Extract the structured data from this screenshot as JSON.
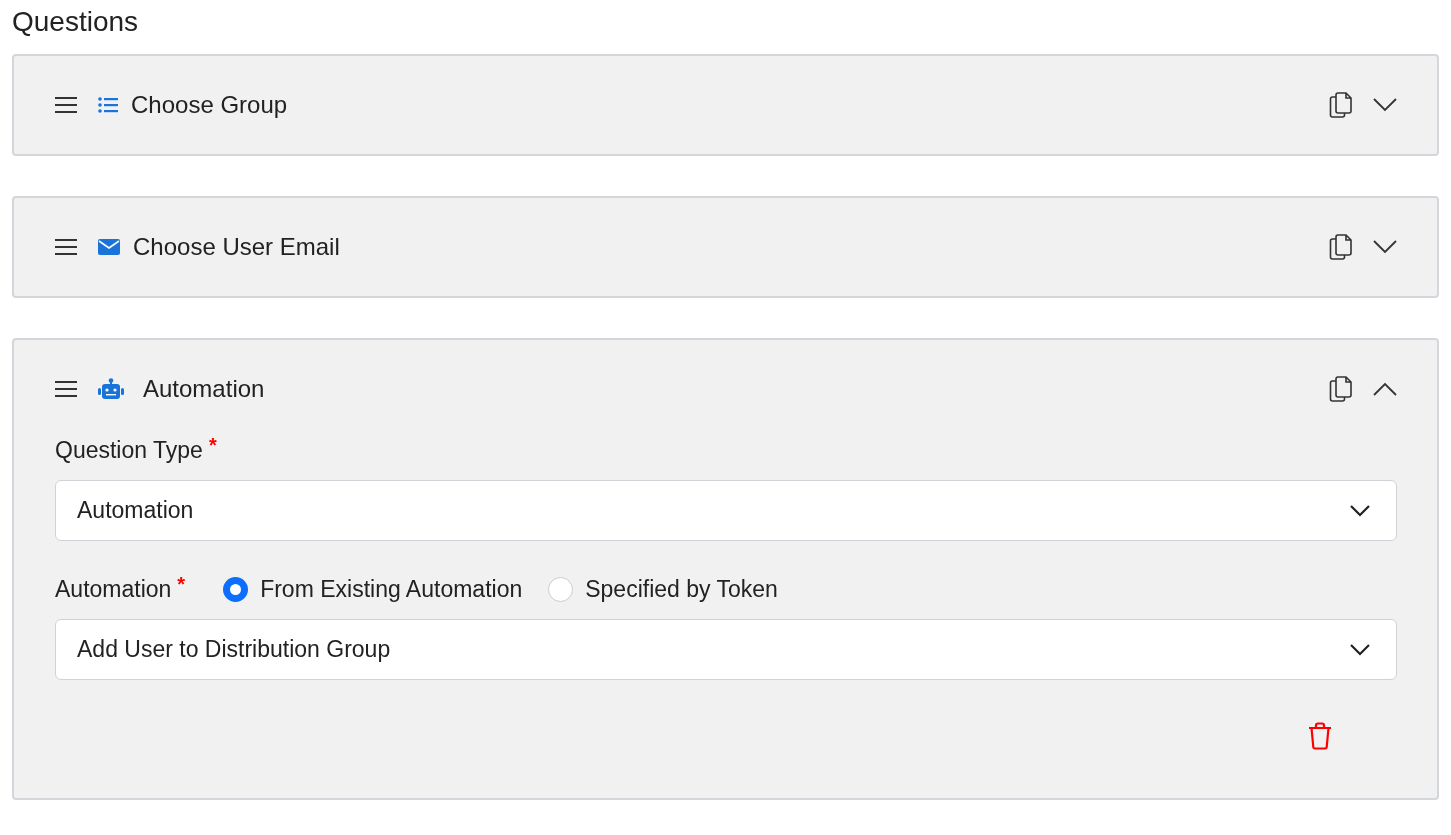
{
  "heading": "Questions",
  "questions": [
    {
      "kind": "list",
      "title": "Choose Group",
      "expanded": false
    },
    {
      "kind": "mail",
      "title": "Choose User Email",
      "expanded": false
    },
    {
      "kind": "robot",
      "title": "Automation",
      "expanded": true,
      "form": {
        "question_type": {
          "label": "Question Type",
          "required_mark": "*",
          "value": "Automation"
        },
        "automation": {
          "label": "Automation",
          "required_mark": "*",
          "options": [
            {
              "label": "From Existing Automation",
              "selected": true
            },
            {
              "label": "Specified by Token",
              "selected": false
            }
          ],
          "value": "Add User to Distribution Group"
        }
      }
    }
  ]
}
